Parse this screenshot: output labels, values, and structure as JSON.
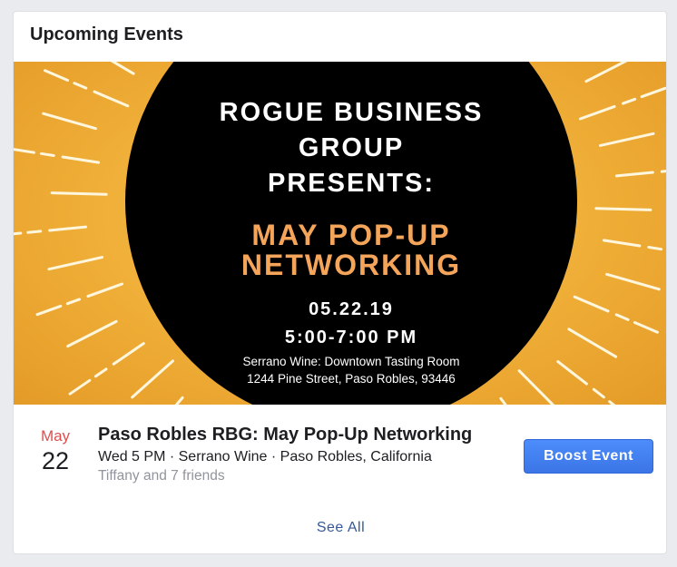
{
  "card": {
    "title": "Upcoming Events",
    "see_all": "See All"
  },
  "banner": {
    "line1": "ROGUE BUSINESS",
    "line2": "GROUP",
    "line3": "PRESENTS:",
    "event_line1": "MAY POP-UP",
    "event_line2": "NETWORKING",
    "date": "05.22.19",
    "time": "5:00-7:00 PM",
    "venue": "Serrano Wine: Downtown Tasting Room",
    "address": "1244 Pine Street, Paso Robles, 93446"
  },
  "event": {
    "month": "May",
    "day": "22",
    "title": "Paso Robles RBG: May Pop-Up Networking",
    "meta": "Wed 5 PM · Serrano Wine · Paso Robles, California",
    "friends": "Tiffany and 7 friends",
    "boost_label": "Boost Event"
  },
  "colors": {
    "accent": "#4080ff",
    "month_red": "#e04f4f",
    "link": "#365899",
    "banner_orange": "#f4a55a",
    "banner_gold": "#efae37"
  }
}
